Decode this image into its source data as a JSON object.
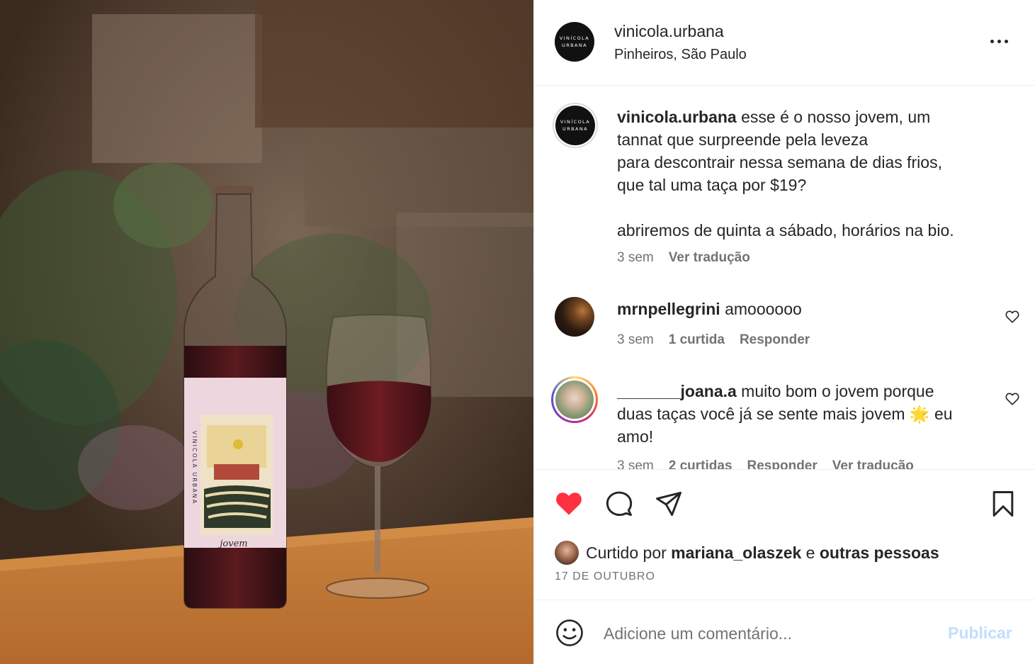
{
  "post": {
    "logo_line1": "VINÍCOLA",
    "logo_line2": "URBANA",
    "bottle_label_brand": "VINICOLA URBANA",
    "bottle_label_name": "jovem"
  },
  "header": {
    "username": "vinicola.urbana",
    "location": "Pinheiros, São Paulo",
    "more_icon": "more-horizontal-icon"
  },
  "caption": {
    "username": "vinicola.urbana",
    "line1": " esse é o nosso jovem, um",
    "line2": "tannat que surpreende pela leveza",
    "line3": "para descontrair nessa semana de dias frios,",
    "line4": "que tal uma taça por $19?",
    "line5": "abriremos de quinta a sábado, horários na bio.",
    "time": "3 sem",
    "translate": "Ver tradução"
  },
  "comments": [
    {
      "username": "mrnpellegrini",
      "text": " amoooooo",
      "time": "3 sem",
      "likes": "1 curtida",
      "reply": "Responder"
    },
    {
      "username": "_______joana.a",
      "text_part1": " muito bom o jovem porque",
      "text_part2": "duas taças você já se sente mais jovem ",
      "emoji": "🌟",
      "text_part3": " eu",
      "text_part4": "amo!",
      "time": "3 sem",
      "likes": "2 curtidas",
      "reply": "Responder",
      "translate": "Ver tradução"
    }
  ],
  "likes": {
    "prefix": "Curtido por ",
    "user": "mariana_olaszek",
    "middle": " e ",
    "others": "outras pessoas"
  },
  "date": "17 DE OUTUBRO",
  "add_comment": {
    "placeholder": "Adicione um comentário...",
    "publish": "Publicar"
  },
  "colors": {
    "like_red": "#ff3040",
    "text": "#262626",
    "muted": "#737373",
    "publish_disabled": "#c0dffd"
  }
}
